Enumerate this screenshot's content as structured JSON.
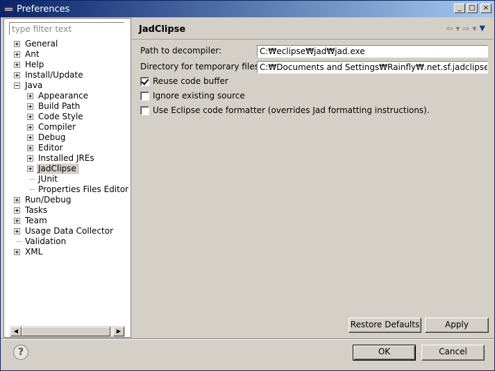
{
  "window": {
    "title": "Preferences",
    "controls": {
      "minimize": "_",
      "maximize": "□",
      "close": "×"
    }
  },
  "filter": {
    "placeholder": "type filter text"
  },
  "tree": [
    {
      "label": "General",
      "level": 0,
      "expander": "plus"
    },
    {
      "label": "Ant",
      "level": 0,
      "expander": "plus"
    },
    {
      "label": "Help",
      "level": 0,
      "expander": "plus"
    },
    {
      "label": "Install/Update",
      "level": 0,
      "expander": "plus"
    },
    {
      "label": "Java",
      "level": 0,
      "expander": "minus"
    },
    {
      "label": "Appearance",
      "level": 1,
      "expander": "plus"
    },
    {
      "label": "Build Path",
      "level": 1,
      "expander": "plus"
    },
    {
      "label": "Code Style",
      "level": 1,
      "expander": "plus"
    },
    {
      "label": "Compiler",
      "level": 1,
      "expander": "plus"
    },
    {
      "label": "Debug",
      "level": 1,
      "expander": "plus"
    },
    {
      "label": "Editor",
      "level": 1,
      "expander": "plus"
    },
    {
      "label": "Installed JREs",
      "level": 1,
      "expander": "plus"
    },
    {
      "label": "JadClipse",
      "level": 1,
      "expander": "plus",
      "selected": true
    },
    {
      "label": "JUnit",
      "level": 1,
      "expander": "none"
    },
    {
      "label": "Properties Files Editor",
      "level": 1,
      "expander": "none"
    },
    {
      "label": "Run/Debug",
      "level": 0,
      "expander": "plus"
    },
    {
      "label": "Tasks",
      "level": 0,
      "expander": "plus"
    },
    {
      "label": "Team",
      "level": 0,
      "expander": "plus"
    },
    {
      "label": "Usage Data Collector",
      "level": 0,
      "expander": "plus"
    },
    {
      "label": "Validation",
      "level": 0,
      "expander": "none"
    },
    {
      "label": "XML",
      "level": 0,
      "expander": "plus"
    }
  ],
  "page": {
    "title": "JadClipse",
    "nav": {
      "back": "⇦",
      "back_menu": "▾",
      "forward": "⇨",
      "forward_menu": "▾",
      "view_menu": "▼"
    },
    "decompiler_label": "Path to decompiler:",
    "decompiler_value": "C:₩eclipse₩jad₩jad.exe",
    "tempdir_label": "Directory for temporary files:",
    "tempdir_value": "C:₩Documents and Settings₩Rainfly₩.net.sf.jadclipse",
    "options": [
      {
        "label": "Reuse code buffer",
        "checked": true
      },
      {
        "label": "Ignore existing source",
        "checked": false
      },
      {
        "label": "Use Eclipse code formatter (overrides Jad formatting instructions).",
        "checked": false
      }
    ],
    "restore_defaults": "Restore Defaults",
    "apply": "Apply"
  },
  "footer": {
    "help": "?",
    "ok": "OK",
    "cancel": "Cancel"
  }
}
